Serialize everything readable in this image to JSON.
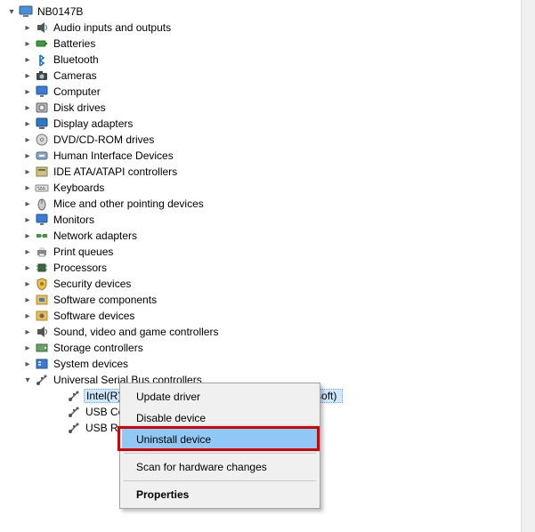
{
  "root": {
    "label": "NB0147B",
    "expanded": true,
    "icon": "computer"
  },
  "categories": [
    {
      "label": "Audio inputs and outputs",
      "icon": "audio",
      "chev": "right"
    },
    {
      "label": "Batteries",
      "icon": "battery",
      "chev": "right"
    },
    {
      "label": "Bluetooth",
      "icon": "bluetooth",
      "chev": "right"
    },
    {
      "label": "Cameras",
      "icon": "camera",
      "chev": "right"
    },
    {
      "label": "Computer",
      "icon": "monitor",
      "chev": "right"
    },
    {
      "label": "Disk drives",
      "icon": "disk",
      "chev": "right"
    },
    {
      "label": "Display adapters",
      "icon": "display",
      "chev": "right"
    },
    {
      "label": "DVD/CD-ROM drives",
      "icon": "cd",
      "chev": "right"
    },
    {
      "label": "Human Interface Devices",
      "icon": "hid",
      "chev": "right"
    },
    {
      "label": "IDE ATA/ATAPI controllers",
      "icon": "ide",
      "chev": "right"
    },
    {
      "label": "Keyboards",
      "icon": "keyboard",
      "chev": "right"
    },
    {
      "label": "Mice and other pointing devices",
      "icon": "mouse",
      "chev": "right"
    },
    {
      "label": "Monitors",
      "icon": "monitor2",
      "chev": "right"
    },
    {
      "label": "Network adapters",
      "icon": "network",
      "chev": "right"
    },
    {
      "label": "Print queues",
      "icon": "printer",
      "chev": "right"
    },
    {
      "label": "Processors",
      "icon": "cpu",
      "chev": "right"
    },
    {
      "label": "Security devices",
      "icon": "security",
      "chev": "right"
    },
    {
      "label": "Software components",
      "icon": "softcomp",
      "chev": "right"
    },
    {
      "label": "Software devices",
      "icon": "softdev",
      "chev": "right"
    },
    {
      "label": "Sound, video and game controllers",
      "icon": "sound",
      "chev": "right"
    },
    {
      "label": "Storage controllers",
      "icon": "storage",
      "chev": "right"
    },
    {
      "label": "System devices",
      "icon": "system",
      "chev": "right"
    },
    {
      "label": "Universal Serial Bus controllers",
      "icon": "usb",
      "chev": "down"
    }
  ],
  "usb_devices": [
    {
      "label": "Intel(R) U",
      "tail": "osoft)",
      "selected": true
    },
    {
      "label": "USB Com"
    },
    {
      "label": "USB Root"
    }
  ],
  "context_menu": {
    "items": [
      {
        "label": "Update driver",
        "kind": "item"
      },
      {
        "label": "Disable device",
        "kind": "item"
      },
      {
        "label": "Uninstall device",
        "kind": "item",
        "highlight": true,
        "redbox": true
      },
      {
        "kind": "sep"
      },
      {
        "label": "Scan for hardware changes",
        "kind": "item"
      },
      {
        "kind": "sep"
      },
      {
        "label": "Properties",
        "kind": "item",
        "bold": true
      }
    ]
  }
}
